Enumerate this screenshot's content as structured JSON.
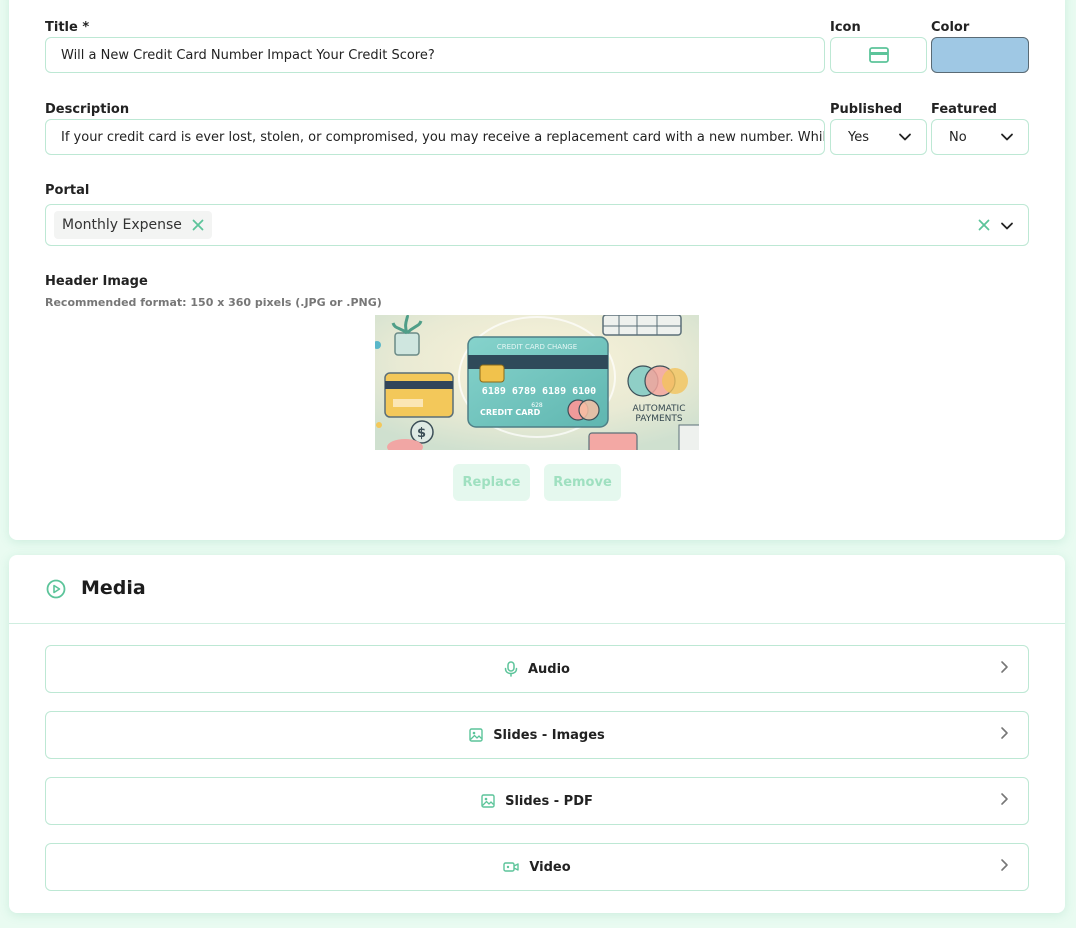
{
  "form": {
    "title_label": "Title *",
    "title_value": "Will a New Credit Card Number Impact Your Credit Score?",
    "icon_label": "Icon",
    "icon_name": "credit-card-icon",
    "color_label": "Color",
    "color_value": "#9fc8e4",
    "description_label": "Description",
    "description_value": "If your credit card is ever lost, stolen, or compromised, you may receive a replacement card with a new number. While th",
    "published_label": "Published",
    "published_value": "Yes",
    "featured_label": "Featured",
    "featured_value": "No",
    "portal_label": "Portal",
    "portal_tags": [
      "Monthly Expense"
    ],
    "header_image_label": "Header Image",
    "header_image_hint": "Recommended format: 150 x 360 pixels (.JPG or .PNG)",
    "header_image_caption": "CREDIT CARD CHANGE",
    "header_image_card_number": "6189 6789 6189 6100",
    "header_image_card_text": "CREDIT CARD",
    "header_image_card_small": "628",
    "header_image_side_text_1": "AUTOMATIC",
    "header_image_side_text_2": "PAYMENTS",
    "replace_label": "Replace",
    "remove_label": "Remove"
  },
  "media": {
    "title": "Media",
    "items": [
      {
        "label": "Audio",
        "icon": "microphone-icon"
      },
      {
        "label": "Slides - Images",
        "icon": "image-icon"
      },
      {
        "label": "Slides - PDF",
        "icon": "image-icon"
      },
      {
        "label": "Video",
        "icon": "video-icon"
      }
    ]
  },
  "colors": {
    "accent": "#5cc49a",
    "border": "#bde8d4",
    "background": "#e9fbf1"
  }
}
